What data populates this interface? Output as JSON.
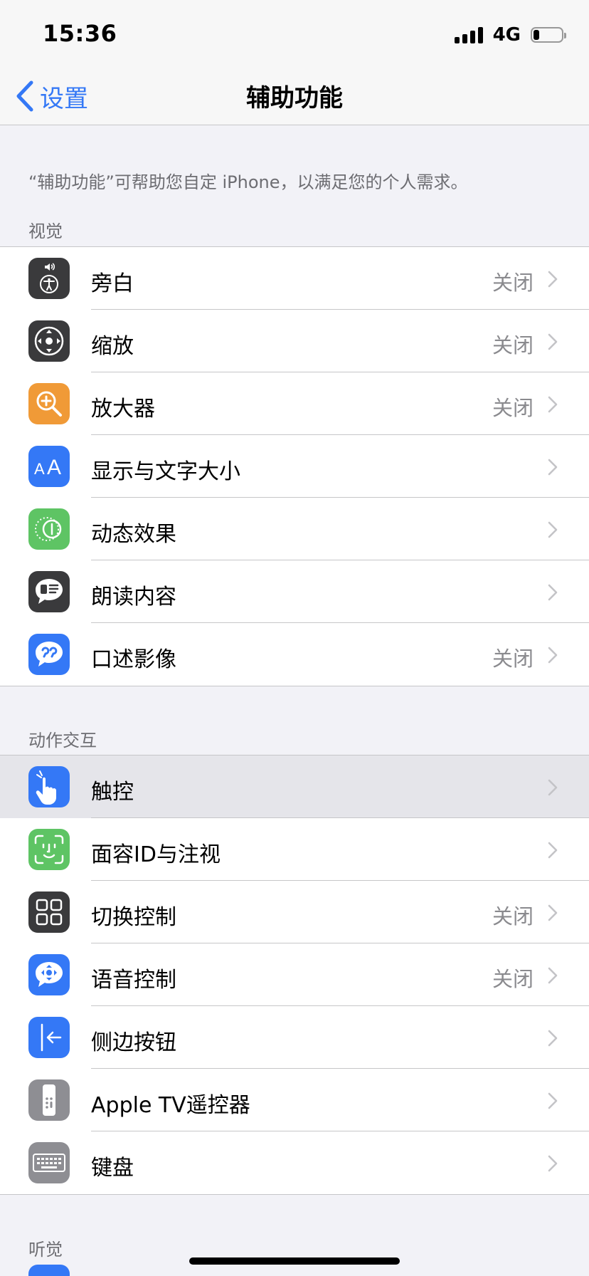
{
  "status_bar": {
    "time": "15:36",
    "network": "4G",
    "battery_level": 0.2
  },
  "nav": {
    "back_label": "设置",
    "title": "辅助功能"
  },
  "description": "“辅助功能”可帮助您自定 iPhone，以满足您的个人需求。",
  "sections": {
    "vision": {
      "header": "视觉",
      "items": [
        {
          "label": "旁白",
          "value": "关闭",
          "icon": "voiceover-icon",
          "color": "#3a3a3c"
        },
        {
          "label": "缩放",
          "value": "关闭",
          "icon": "zoom-icon",
          "color": "#3a3a3c"
        },
        {
          "label": "放大器",
          "value": "关闭",
          "icon": "magnifier-icon",
          "color": "#f09a37"
        },
        {
          "label": "显示与文字大小",
          "value": "",
          "icon": "text-size-icon",
          "color": "#3478f6"
        },
        {
          "label": "动态效果",
          "value": "",
          "icon": "motion-icon",
          "color": "#5ec464"
        },
        {
          "label": "朗读内容",
          "value": "",
          "icon": "spoken-content-icon",
          "color": "#3a3a3c"
        },
        {
          "label": "口述影像",
          "value": "关闭",
          "icon": "audio-descriptions-icon",
          "color": "#3478f6"
        }
      ]
    },
    "interaction": {
      "header": "动作交互",
      "items": [
        {
          "label": "触控",
          "value": "",
          "icon": "touch-icon",
          "color": "#3478f6"
        },
        {
          "label": "面容ID与注视",
          "value": "",
          "icon": "face-id-icon",
          "color": "#5ec464"
        },
        {
          "label": "切换控制",
          "value": "关闭",
          "icon": "switch-control-icon",
          "color": "#3a3a3c"
        },
        {
          "label": "语音控制",
          "value": "关闭",
          "icon": "voice-control-icon",
          "color": "#3478f6"
        },
        {
          "label": "侧边按钮",
          "value": "",
          "icon": "side-button-icon",
          "color": "#3478f6"
        },
        {
          "label": "Apple TV遥控器",
          "value": "",
          "icon": "apple-tv-remote-icon",
          "color": "#8e8e93"
        },
        {
          "label": "键盘",
          "value": "",
          "icon": "keyboard-icon",
          "color": "#8e8e93"
        }
      ]
    },
    "hearing": {
      "header": "听觉"
    }
  },
  "colors": {
    "accent": "#3478f6",
    "background": "#f2f2f7",
    "secondary_text": "#8a8a8e"
  }
}
